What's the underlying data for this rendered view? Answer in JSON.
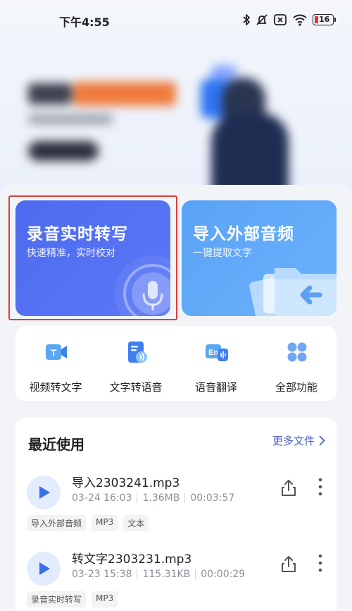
{
  "status_bar": {
    "time": "下午4:55",
    "battery_level": "16",
    "icons": [
      "bluetooth-icon",
      "mute-icon",
      "no-sim-icon",
      "wifi-icon",
      "battery-icon"
    ]
  },
  "cards": {
    "record": {
      "title": "录音实时转写",
      "subtitle": "快速精准，实时校对",
      "icon": "microphone-icon"
    },
    "import": {
      "title": "导入外部音频",
      "subtitle": "一键提取文字",
      "icon": "folder-import-icon"
    }
  },
  "tools": [
    {
      "label": "视频转文字",
      "icon": "video-to-text-icon"
    },
    {
      "label": "文字转语音",
      "icon": "text-to-speech-icon"
    },
    {
      "label": "语音翻译",
      "icon": "voice-translate-icon"
    },
    {
      "label": "全部功能",
      "icon": "all-features-icon"
    }
  ],
  "recent": {
    "title": "最近使用",
    "more_label": "更多文件",
    "files": [
      {
        "name": "导入2303241.mp3",
        "date": "03-24 16:03",
        "size": "1.36MB",
        "duration": "00:03:57",
        "tags": [
          "导入外部音频",
          "MP3",
          "文本"
        ]
      },
      {
        "name": "转文字2303231.mp3",
        "date": "03-23 15:38",
        "size": "115.31KB",
        "duration": "00:00:29",
        "tags": [
          "录音实时转写",
          "MP3"
        ]
      }
    ]
  },
  "colors": {
    "record_card": "#4e6bf0",
    "import_card": "#5aa2f6",
    "highlight_frame": "#d9403a",
    "link": "#4b62c8"
  }
}
